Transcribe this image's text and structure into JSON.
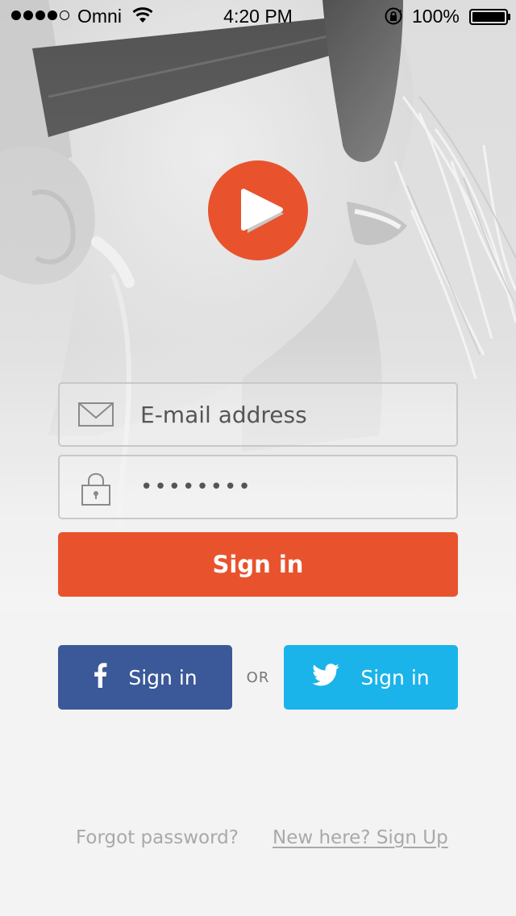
{
  "status_bar": {
    "carrier": "Omni",
    "time": "4:20 PM",
    "battery": "100%",
    "signal_strength": 4,
    "signal_max": 5,
    "icons": [
      "wifi-icon",
      "rotation-lock-icon",
      "battery-icon"
    ]
  },
  "logo": {
    "icon": "play-icon",
    "color": "#e8532d"
  },
  "form": {
    "email": {
      "placeholder": "E-mail address",
      "value": "",
      "icon": "envelope-icon"
    },
    "password": {
      "value": "••••••••",
      "icon": "lock-icon"
    },
    "signin_label": "Sign in"
  },
  "social": {
    "facebook_label": "Sign in",
    "twitter_label": "Sign in",
    "or_label": "OR",
    "facebook_color": "#3b5998",
    "twitter_color": "#1ab4ea"
  },
  "links": {
    "forgot": "Forgot password?",
    "signup": "New here? Sign Up"
  },
  "colors": {
    "accent": "#e8532d",
    "background": "#f3f3f3"
  }
}
